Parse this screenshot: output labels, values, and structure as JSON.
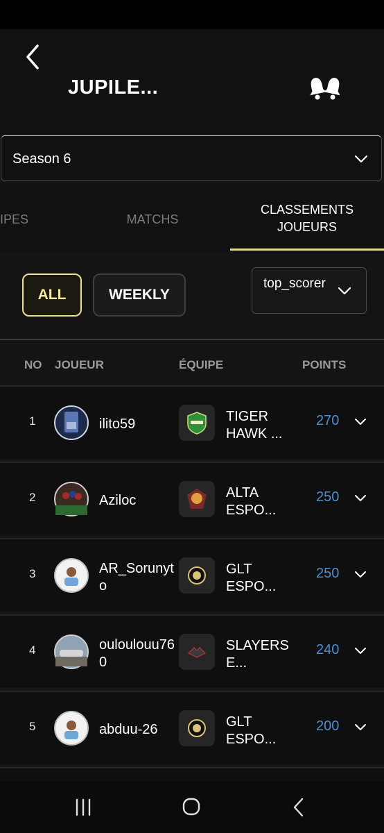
{
  "header": {
    "title": "JUPILE...",
    "back_icon": "chevron-left-icon",
    "notify_icon": "bell-icon"
  },
  "season": {
    "selected": "Season 6"
  },
  "tabs": [
    {
      "label": "IPES",
      "active": false
    },
    {
      "label": "MATCHS",
      "active": false
    },
    {
      "label": "CLASSEMENTS JOUEURS",
      "active": true
    }
  ],
  "filters": {
    "all_label": "ALL",
    "weekly_label": "WEEKLY",
    "sort_value": "top_scorer"
  },
  "table": {
    "headers": {
      "no": "NO",
      "player": "JOUEUR",
      "team": "ÉQUIPE",
      "points": "POINTS"
    },
    "rows": [
      {
        "rank": "1",
        "player": "ilito59",
        "team": "TIGER HAWK ...",
        "points": "270"
      },
      {
        "rank": "2",
        "player": "Aziloc",
        "team": "ALTA ESPO...",
        "points": "250"
      },
      {
        "rank": "3",
        "player": "AR_Sorunyto",
        "team": "GLT ESPO...",
        "points": "250"
      },
      {
        "rank": "4",
        "player": "ouloulouu760",
        "team": "SLAYERS E...",
        "points": "240"
      },
      {
        "rank": "5",
        "player": "abduu-26",
        "team": "GLT ESPO...",
        "points": "200"
      }
    ]
  },
  "colors": {
    "accent": "#e7d99a",
    "points": "#4e8fd0",
    "background": "#151515"
  },
  "nav": [
    "recent-apps-icon",
    "home-icon",
    "back-icon"
  ]
}
